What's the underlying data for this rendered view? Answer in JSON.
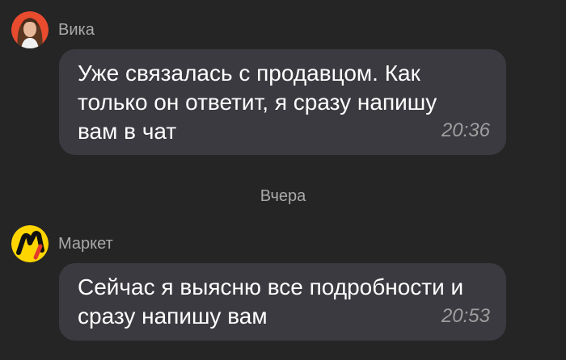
{
  "messages": [
    {
      "sender": "Вика",
      "avatar_icon": "user-photo-avatar",
      "text": "Уже связалась с продавцом. Как только он ответит, я сразу напишу вам в чат",
      "time": "20:36"
    },
    {
      "sender": "Маркет",
      "avatar_icon": "yandex-market-logo-icon",
      "text": "Сейчас я выясню все подробности и сразу напишу вам",
      "time": "20:53"
    }
  ],
  "date_separator": "Вчера",
  "colors": {
    "background": "#252525",
    "bubble": "#3a3a40",
    "muted_text": "#a9a9a9",
    "market_yellow": "#ffd500"
  }
}
